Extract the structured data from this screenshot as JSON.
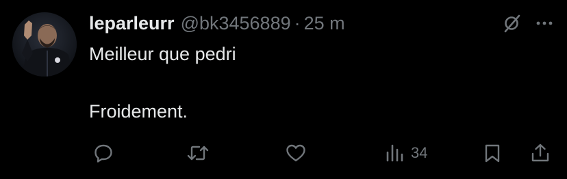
{
  "tweet": {
    "author": {
      "display_name": "leparleurr",
      "handle": "@bk3456889",
      "avatar": "profile-photo"
    },
    "separator": "·",
    "time": "25 m",
    "text_lines": [
      "Meilleur que pedri",
      "Froidement."
    ],
    "header_icons": [
      "grok-icon",
      "more-icon"
    ],
    "actions": {
      "reply": {
        "icon": "reply-icon"
      },
      "repost": {
        "icon": "repost-icon"
      },
      "like": {
        "icon": "like-icon"
      },
      "views": {
        "icon": "views-icon",
        "count": "34"
      },
      "bookmark": {
        "icon": "bookmark-icon"
      },
      "share": {
        "icon": "share-icon"
      }
    }
  },
  "colors": {
    "background": "#000000",
    "primary_text": "#e7e9ea",
    "secondary_text": "#71767b"
  }
}
